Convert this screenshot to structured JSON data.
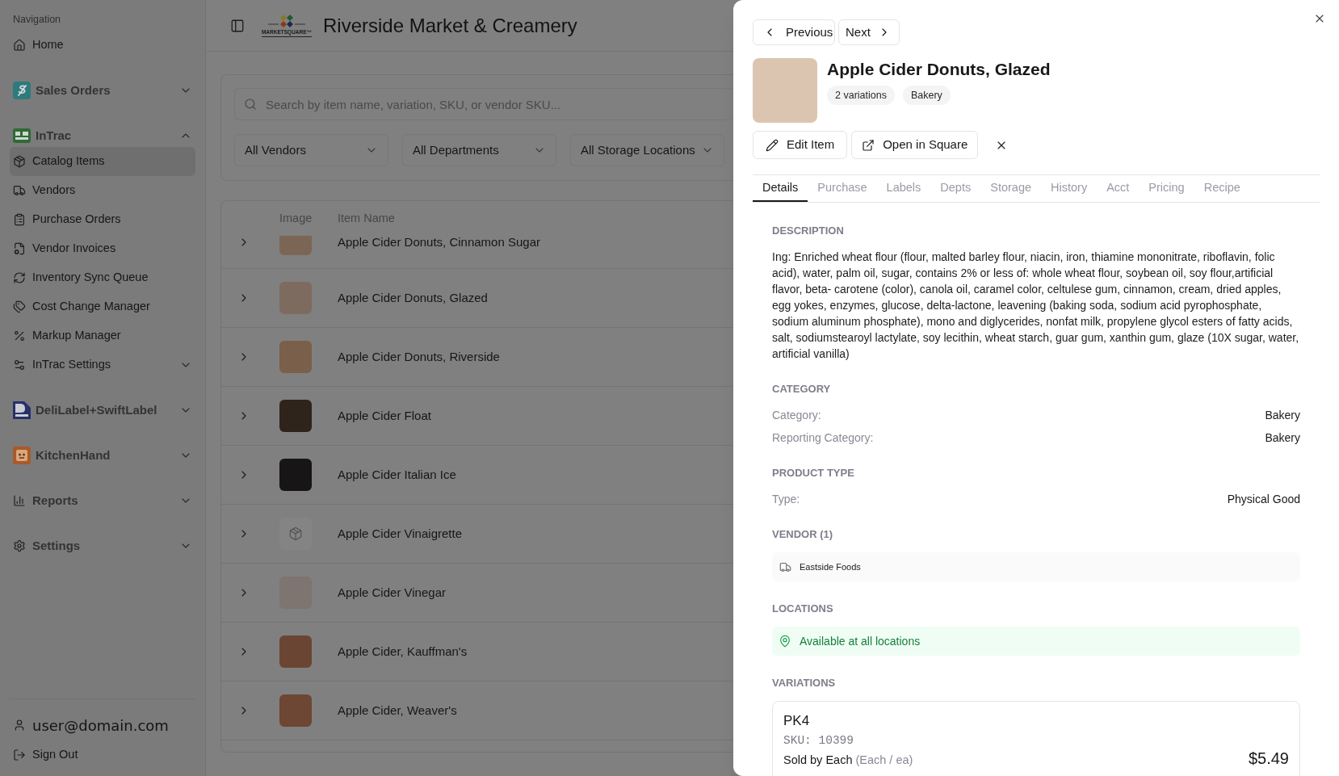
{
  "sidebar": {
    "heading": "Navigation",
    "items": [
      {
        "kind": "link",
        "label": "Home",
        "selected": false
      },
      {
        "kind": "app",
        "label": "Sales Orders",
        "selected": false,
        "expanded": false
      },
      {
        "kind": "app",
        "label": "InTrac",
        "selected": false,
        "expanded": true,
        "children": [
          {
            "kind": "link",
            "label": "Catalog Items",
            "selected": true
          },
          {
            "kind": "link",
            "label": "Vendors",
            "selected": false
          },
          {
            "kind": "link",
            "label": "Purchase Orders",
            "selected": false
          },
          {
            "kind": "link",
            "label": "Vendor Invoices",
            "selected": false
          },
          {
            "kind": "link",
            "label": "Inventory Sync Queue",
            "selected": false
          },
          {
            "kind": "link",
            "label": "Cost Change Manager",
            "selected": false
          },
          {
            "kind": "link",
            "label": "Markup Manager",
            "selected": false
          },
          {
            "kind": "group",
            "label": "InTrac Settings",
            "selected": false,
            "expanded": false
          }
        ]
      },
      {
        "kind": "app",
        "label": "DeliLabel+SwiftLabel",
        "selected": false,
        "expanded": false
      },
      {
        "kind": "app",
        "label": "KitchenHand",
        "selected": false,
        "expanded": false
      },
      {
        "kind": "group",
        "label": "Reports",
        "selected": false,
        "expanded": false
      },
      {
        "kind": "group",
        "label": "Settings",
        "selected": false,
        "expanded": false
      }
    ],
    "user": "user@domain.com",
    "sign_out": "Sign Out"
  },
  "header": {
    "logo_text": "MARKETSQUARE™",
    "title": "Riverside Market & Creamery"
  },
  "filters": {
    "search": {
      "placeholder": "Search by item name, variation, SKU, or vendor SKU..."
    },
    "dropdowns": [
      "All Vendors",
      "All Departments",
      "All Storage Locations"
    ]
  },
  "table": {
    "columns": [
      "Image",
      "Item Name"
    ],
    "rows": [
      {
        "kind": "photo",
        "name": "Apple Cider Donuts, Cinnamon Sugar",
        "expanded": false
      },
      {
        "kind": "photo",
        "name": "Apple Cider Donuts, Glazed",
        "expanded": false
      },
      {
        "kind": "photo",
        "name": "Apple Cider Donuts, Riverside",
        "expanded": false
      },
      {
        "kind": "photo",
        "name": "Apple Cider Float",
        "expanded": false
      },
      {
        "kind": "photo",
        "name": "Apple Cider Italian Ice",
        "expanded": false
      },
      {
        "kind": "placeholder",
        "name": "Apple Cider Vinaigrette",
        "expanded": false
      },
      {
        "kind": "photo",
        "name": "Apple Cider Vinegar",
        "expanded": false
      },
      {
        "kind": "photo",
        "name": "Apple Cider, Kauffman's",
        "expanded": false
      },
      {
        "kind": "photo",
        "name": "Apple Cider, Weaver's",
        "expanded": false
      }
    ]
  },
  "panel": {
    "nav": {
      "previous": "Previous",
      "next": "Next"
    },
    "title": "Apple Cider Donuts, Glazed",
    "badges": [
      "2 variations",
      "Bakery"
    ],
    "actions": {
      "edit": "Edit Item",
      "open": "Open in Square"
    },
    "tabs": [
      {
        "label": "Details",
        "selected": true
      },
      {
        "label": "Purchase",
        "selected": false
      },
      {
        "label": "Labels",
        "selected": false
      },
      {
        "label": "Depts",
        "selected": false
      },
      {
        "label": "Storage",
        "selected": false
      },
      {
        "label": "History",
        "selected": false
      },
      {
        "label": "Acct",
        "selected": false
      },
      {
        "label": "Pricing",
        "selected": false
      },
      {
        "label": "Recipe",
        "selected": false
      }
    ],
    "sections": [
      {
        "kind": "text",
        "heading": "DESCRIPTION",
        "text": "Ing: Enriched wheat flour (flour, malted barley flour, niacin, iron, thiamine mononitrate, riboflavin, folic acid), water, palm oil, sugar, contains 2% or less of: whole wheat flour, soybean oil, soy flour,artificial flavor, beta- carotene (color), canola oil, caramel color, celtulese gum, cinnamon, cream, dried apples, egg yokes, enzymes, glucose, delta-lactone, leavening (baking soda, sodium acid pyrophosphate, sodium aluminum phosphate), mono and diglycerides, nonfat milk, propylene glycol esters of fatty acids, salt, sodiumstearoyl lactylate, soy lecithin, wheat starch, guar gum, xanthin gum, glaze (10X sugar, water, artificial vanilla)"
      },
      {
        "kind": "fields",
        "heading": "CATEGORY",
        "fields": [
          {
            "label": "Category:",
            "value": "Bakery"
          },
          {
            "label": "Reporting Category:",
            "value": "Bakery"
          }
        ]
      },
      {
        "kind": "fields",
        "heading": "PRODUCT TYPE",
        "fields": [
          {
            "label": "Type:",
            "value": "Physical Good"
          }
        ]
      },
      {
        "kind": "vendors",
        "heading": "VENDOR (1)",
        "vendors": [
          "Eastside Foods"
        ]
      },
      {
        "kind": "locations",
        "heading": "LOCATIONS",
        "text": "Available at all locations"
      },
      {
        "kind": "variations",
        "heading": "VARIATIONS",
        "variations": [
          {
            "name": "PK4",
            "sku": "SKU: 10399",
            "sold_by": "Sold by Each",
            "unit": "(Each / ea)",
            "price": "$5.49"
          }
        ]
      }
    ]
  }
}
